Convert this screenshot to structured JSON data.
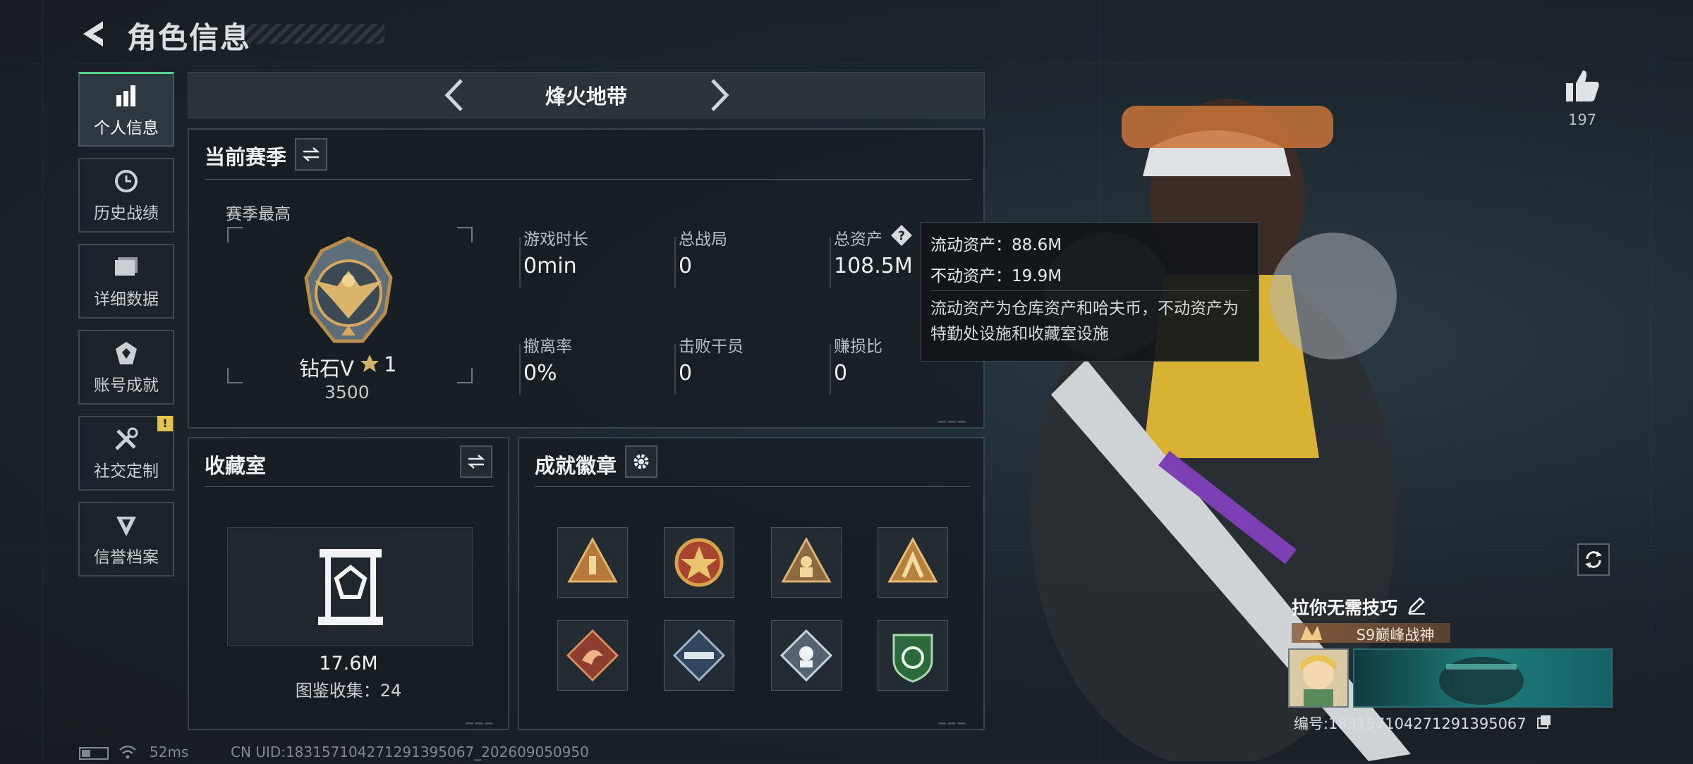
{
  "header": {
    "title": "角色信息"
  },
  "nav": {
    "items": [
      {
        "label": "个人信息",
        "icon": "bar-chart-icon",
        "active": true
      },
      {
        "label": "历史战绩",
        "icon": "history-clock-icon"
      },
      {
        "label": "详细数据",
        "icon": "folder-icon"
      },
      {
        "label": "账号成就",
        "icon": "achievement-icon"
      },
      {
        "label": "社交定制",
        "icon": "tools-icon",
        "badge": "!"
      },
      {
        "label": "信誉档案",
        "icon": "credit-shield-icon"
      }
    ]
  },
  "map_selector": {
    "current": "烽火地带"
  },
  "season": {
    "title": "当前赛季",
    "best_label": "赛季最高",
    "rank_name": "钻石V",
    "rank_stars": "1",
    "rank_points": "3500",
    "stats": [
      {
        "label": "游戏时长",
        "value": "0min"
      },
      {
        "label": "总战局",
        "value": "0"
      },
      {
        "label": "总资产",
        "value": "108.5M"
      },
      {
        "label": "撤离率",
        "value": "0%"
      },
      {
        "label": "击败干员",
        "value": "0"
      },
      {
        "label": "赚损比",
        "value": "0"
      }
    ]
  },
  "tooltip": {
    "liquid": "流动资产：88.6M",
    "fixed": "不动资产：19.9M",
    "desc": "流动资产为仓库资产和哈夫币，不动资产为特勤处设施和收藏室设施"
  },
  "collection": {
    "title": "收藏室",
    "value": "17.6M",
    "count_text": "图鉴收集：24"
  },
  "badges": {
    "title": "成就徽章",
    "items": [
      "badge-icon",
      "badge-icon",
      "badge-icon",
      "badge-icon",
      "badge-icon",
      "badge-icon",
      "badge-icon",
      "badge-icon"
    ]
  },
  "profile": {
    "likes": "197",
    "name": "拉你无需技巧",
    "rank_title": "S9巅峰战神",
    "id_text": "编号:183157104271291395067"
  },
  "status": {
    "ping": "52ms",
    "uid": "CN UID:183157104271291395067_202609050950"
  },
  "colors": {
    "accent": "#57d38c",
    "warning": "#e5c24a"
  }
}
